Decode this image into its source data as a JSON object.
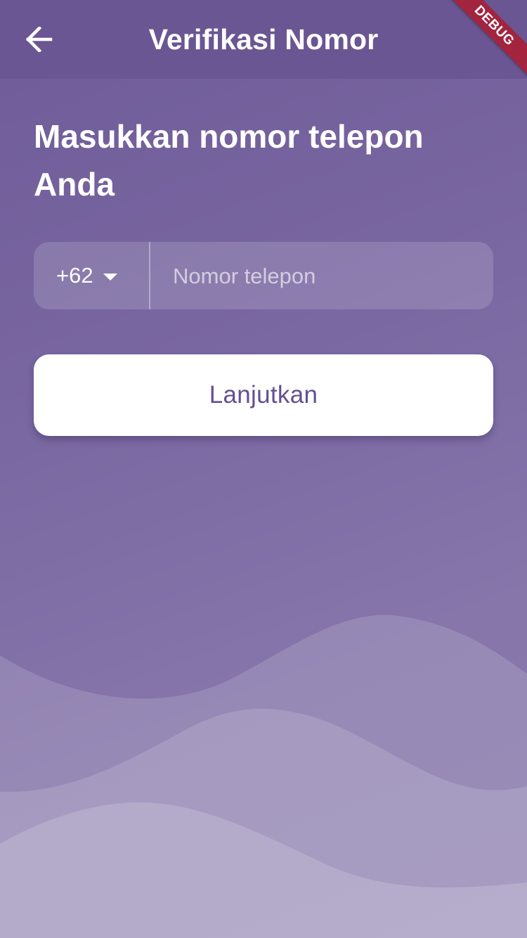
{
  "app_bar": {
    "title": "Verifikasi Nomor",
    "back_icon": "arrow-left-icon"
  },
  "debug_banner": "DEBUG",
  "heading": "Masukkan nomor telepon Anda",
  "phone_field": {
    "country_code": "+62",
    "dropdown_icon": "caret-down-icon",
    "value": "",
    "placeholder": "Nomor telepon"
  },
  "continue_button": {
    "label": "Lanjutkan"
  },
  "colors": {
    "background": "#7a68a2",
    "app_bar": "#6a5693",
    "button_text": "#654f92",
    "button_bg": "#ffffff",
    "debug_banner": "#a3243e"
  }
}
